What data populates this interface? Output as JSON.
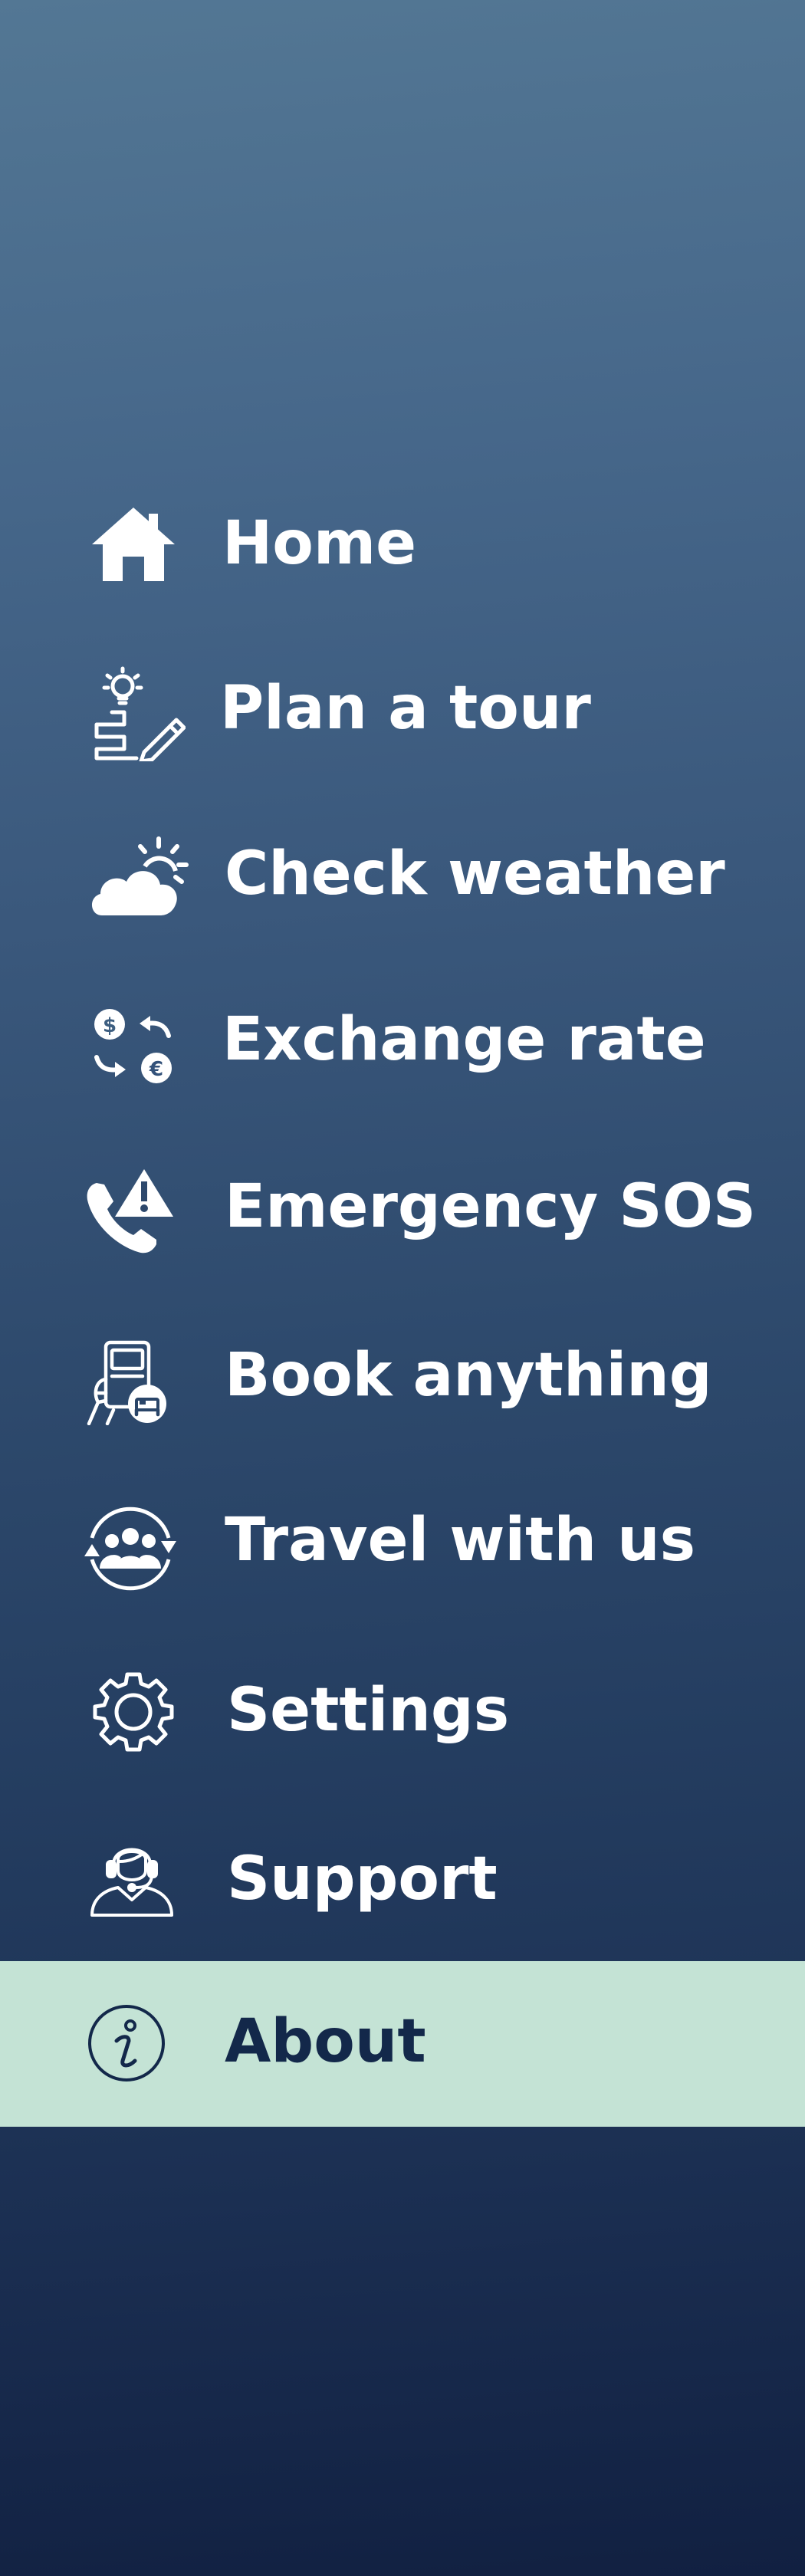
{
  "theme": {
    "gradient_top": "#537794",
    "gradient_bottom": "#112041",
    "text_color": "#ffffff",
    "active_background": "#c4e3d5",
    "active_text_color": "#13284a"
  },
  "menu": {
    "active_index": 9,
    "items": [
      {
        "label": "Home",
        "icon": "home-icon"
      },
      {
        "label": "Plan a tour",
        "icon": "plan-tour-icon"
      },
      {
        "label": "Check weather",
        "icon": "weather-icon"
      },
      {
        "label": "Exchange rate",
        "icon": "exchange-rate-icon"
      },
      {
        "label": "Emergency SOS",
        "icon": "emergency-sos-icon"
      },
      {
        "label": "Book anything",
        "icon": "booking-icon"
      },
      {
        "label": "Travel with us",
        "icon": "group-travel-icon"
      },
      {
        "label": "Settings",
        "icon": "gear-icon"
      },
      {
        "label": "Support",
        "icon": "support-headset-icon"
      },
      {
        "label": "About",
        "icon": "info-icon"
      }
    ]
  }
}
